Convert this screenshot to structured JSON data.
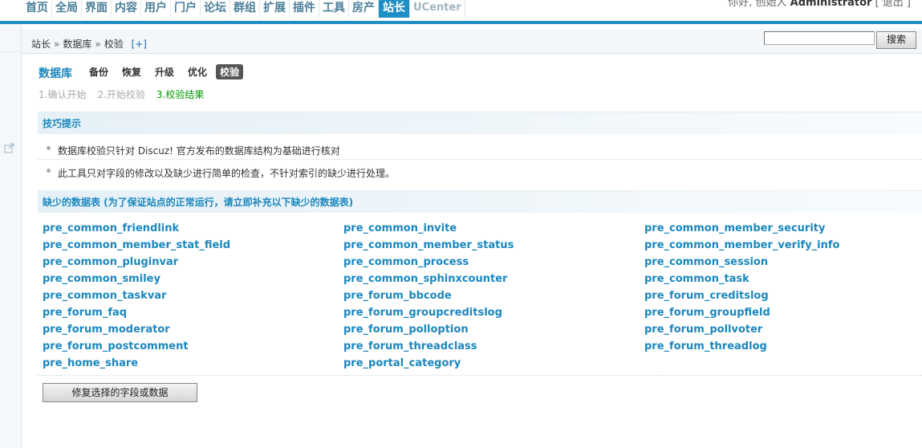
{
  "topnav": {
    "tabs": [
      "首页",
      "全局",
      "界面",
      "内容",
      "用户",
      "门户",
      "论坛",
      "群组",
      "扩展",
      "插件",
      "工具",
      "房产",
      "站长",
      "UCenter"
    ],
    "active_index": 12,
    "user_text": "你好, 创始人",
    "username": "Administrator",
    "logout": "[ 退出 ]"
  },
  "breadcrumb": {
    "items": [
      "站长",
      "数据库",
      "校验"
    ],
    "separator": "»",
    "add": "[+]"
  },
  "search": {
    "value": "",
    "button": "搜索"
  },
  "page": {
    "title": "数据库",
    "submenu": [
      "备份",
      "恢复",
      "升级",
      "优化",
      "校验"
    ],
    "active_submenu": "校验",
    "steps": [
      "1.确认开始",
      "2.开始校验",
      "3.校验结果"
    ],
    "current_step": 2
  },
  "tips": {
    "heading": "技巧提示",
    "items": [
      "数据库校验只针对 Discuz! 官方发布的数据库结构为基础进行核对",
      "此工具只对字段的修改以及缺少进行简单的检查，不针对索引的缺少进行处理。"
    ]
  },
  "missing": {
    "heading": "缺少的数据表 (为了保证站点的正常运行，请立即补充以下缺少的数据表)",
    "tables": [
      "pre_common_friendlink",
      "pre_common_invite",
      "pre_common_member_security",
      "pre_common_member_stat_field",
      "pre_common_member_status",
      "pre_common_member_verify_info",
      "pre_common_pluginvar",
      "pre_common_process",
      "pre_common_session",
      "pre_common_smiley",
      "pre_common_sphinxcounter",
      "pre_common_task",
      "pre_common_taskvar",
      "pre_forum_bbcode",
      "pre_forum_creditslog",
      "pre_forum_faq",
      "pre_forum_groupcreditslog",
      "pre_forum_groupfield",
      "pre_forum_moderator",
      "pre_forum_polloption",
      "pre_forum_pollvoter",
      "pre_forum_postcomment",
      "pre_forum_threadclass",
      "pre_forum_threadlog",
      "pre_home_share",
      "pre_portal_category"
    ]
  },
  "actions": {
    "repair": "修复选择的字段或数据"
  },
  "colors": {
    "accent": "#1e8fc4",
    "link": "#1b87be",
    "step_current": "#009900"
  }
}
